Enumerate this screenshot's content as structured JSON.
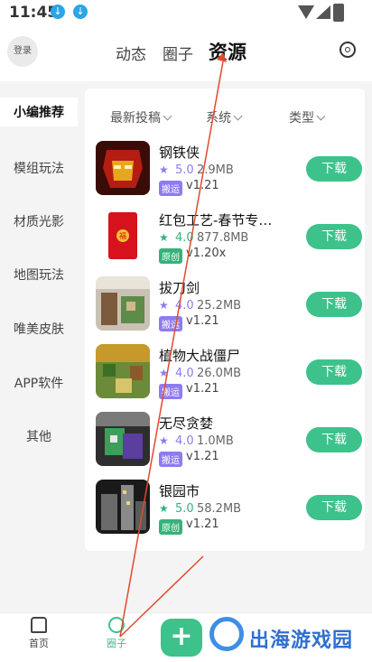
{
  "status": {
    "time": "11:45"
  },
  "header": {
    "login": "登录",
    "tabs": [
      "动态",
      "圈子",
      "资源"
    ],
    "active_tab": "资源"
  },
  "sidebar": {
    "items": [
      "小编推荐",
      "模组玩法",
      "材质光影",
      "地图玩法",
      "唯美皮肤",
      "APP软件",
      "其他"
    ],
    "active": "小编推荐"
  },
  "filters": [
    "最新投稿",
    "系统",
    "类型"
  ],
  "apps": [
    {
      "name": "钢铁侠",
      "rating": "5.0",
      "size": "2.9MB",
      "badge": "搬运",
      "version": "v1.21",
      "button": "下载"
    },
    {
      "name": "红包工艺-春节专属模组",
      "rating": "4.0",
      "size": "877.8MB",
      "badge": "原创",
      "version": "v1.20x",
      "button": "下载"
    },
    {
      "name": "拔刀剑",
      "rating": "4.0",
      "size": "25.2MB",
      "badge": "搬运",
      "version": "v1.21",
      "button": "下载"
    },
    {
      "name": "植物大战僵尸",
      "rating": "4.0",
      "size": "26.0MB",
      "badge": "搬运",
      "version": "v1.21",
      "button": "下载"
    },
    {
      "name": "无尽贪婪",
      "rating": "4.0",
      "size": "1.0MB",
      "badge": "搬运",
      "version": "v1.21",
      "button": "下载"
    },
    {
      "name": "银园市",
      "rating": "5.0",
      "size": "58.2MB",
      "badge": "原创",
      "version": "v1.21",
      "button": "下载"
    }
  ],
  "bottom_nav": {
    "home": "首页",
    "circle": "圈子",
    "add": "+"
  },
  "watermark": "出海游戏园",
  "colors": {
    "accent": "#3cc28a",
    "badge_ban": "#8e7bf0",
    "badge_yuan": "#35b27a",
    "annotation": "#e04a2e"
  }
}
